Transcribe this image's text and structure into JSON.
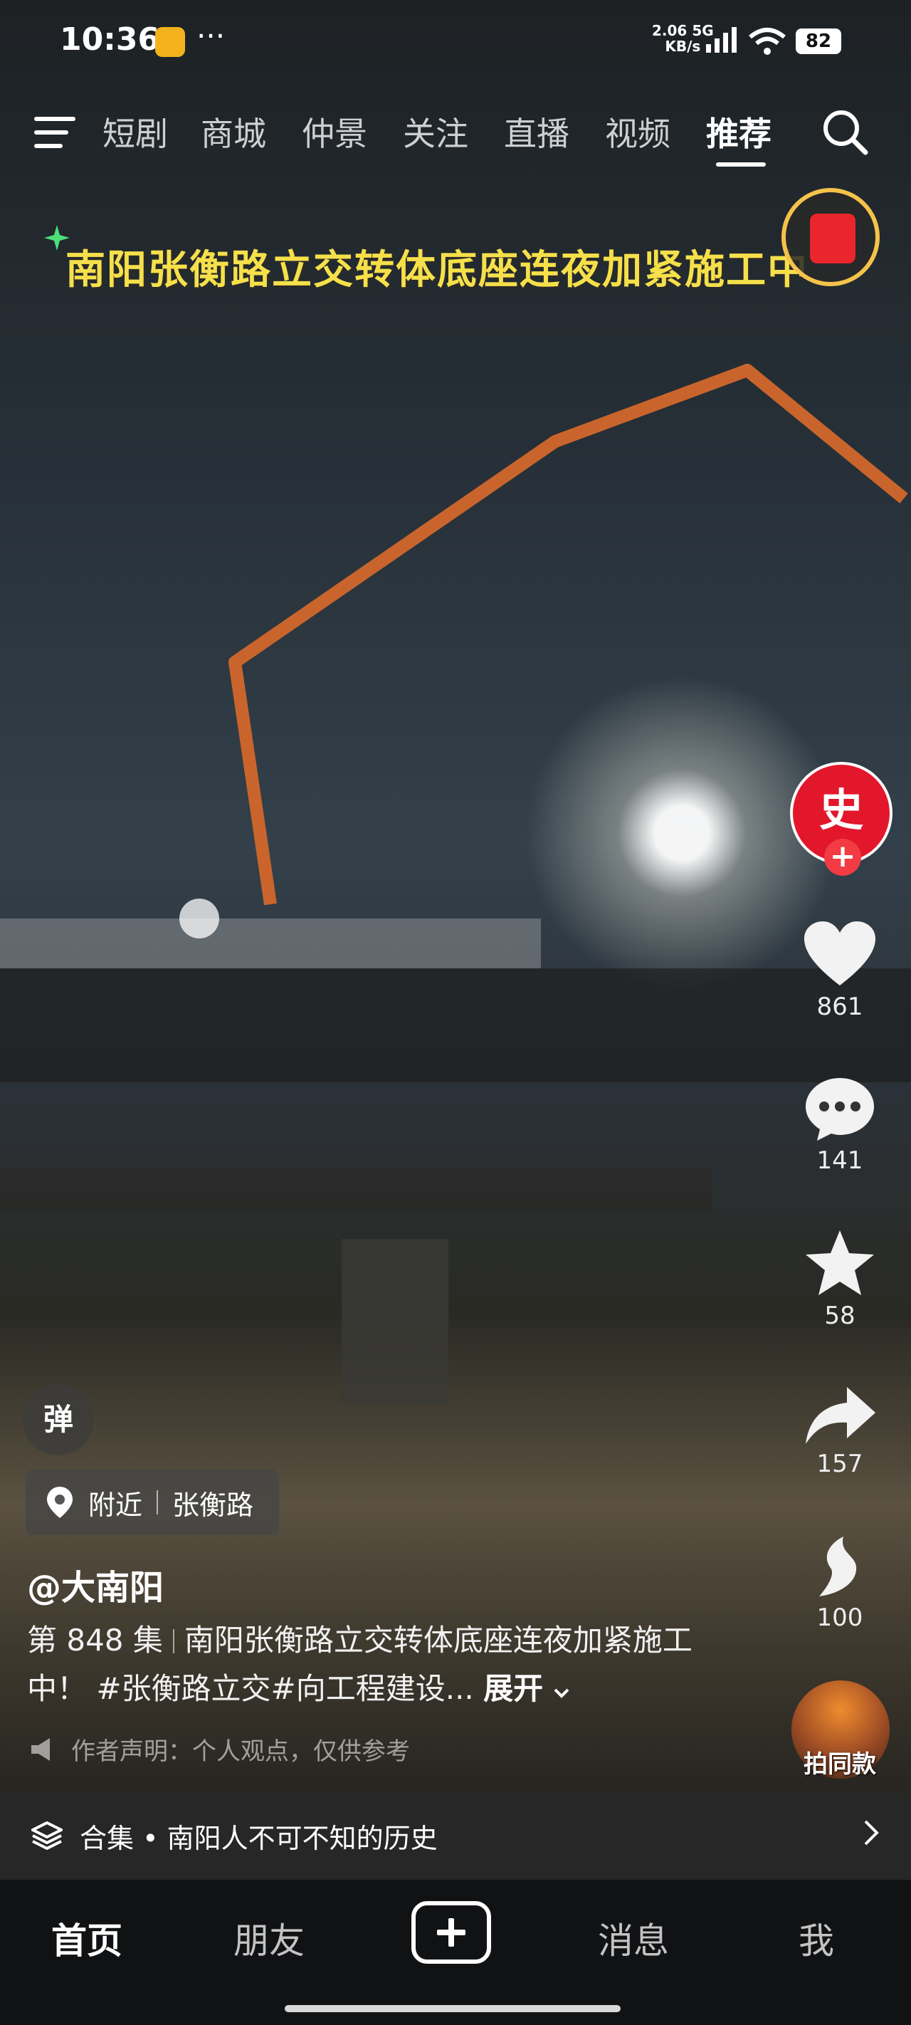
{
  "status_bar": {
    "time": "10:36",
    "more": "···",
    "net_speed_value": "2.06",
    "net_speed_unit": "KB/s",
    "network": "5G",
    "battery": "82"
  },
  "top_nav": {
    "tabs": [
      "短剧",
      "商城",
      "仲景",
      "关注",
      "直播",
      "视频",
      "推荐"
    ],
    "active_tab": "推荐"
  },
  "video": {
    "title_overlay": "南阳张衡路立交转体底座连夜加紧施工中"
  },
  "actions": {
    "likes": "861",
    "comments": "141",
    "favorites": "58",
    "shares": "157",
    "recommend": "100",
    "remix_label": "拍同款",
    "avatar_text": "史"
  },
  "info": {
    "danmaku_label": "弹",
    "location_type": "附近",
    "location_name": "张衡路",
    "author": "@大南阳",
    "episode": "第 848 集",
    "caption": "南阳张衡路立交转体底座连夜加紧施工中！ #张衡路立交#向工程建设...",
    "expand_label": "展开",
    "disclaimer": "作者声明：个人观点，仅供参考"
  },
  "collection": {
    "label": "合集 • 南阳人不可不知的历史"
  },
  "bottom_nav": {
    "home": "首页",
    "friends": "朋友",
    "messages": "消息",
    "me": "我"
  },
  "colors": {
    "title_yellow": "#f6e04a",
    "like_red": "#f23b43",
    "avatar_red": "#e3172b"
  }
}
